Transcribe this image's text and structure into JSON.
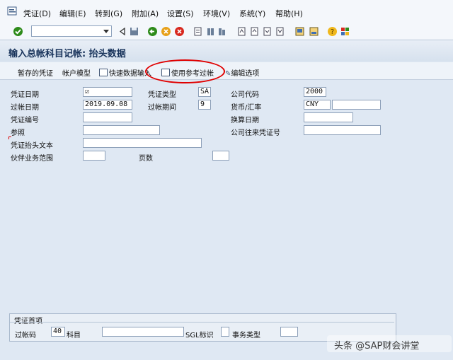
{
  "menu": [
    "凭证(D)",
    "编辑(E)",
    "转到(G)",
    "附加(A)",
    "设置(S)",
    "环境(V)",
    "系统(Y)",
    "帮助(H)"
  ],
  "toolbar": {
    "command_field": "",
    "icons": [
      "enter-icon",
      "back-icon",
      "save-icon",
      "back-green-icon",
      "exit-icon",
      "cancel-icon",
      "print-icon",
      "find-icon",
      "find-next-icon",
      "first-page-icon",
      "prev-page-icon",
      "next-page-icon",
      "last-page-icon",
      "new-session-icon",
      "shortcut-icon",
      "help-icon",
      "layout-icon"
    ],
    "colors": {
      "enter": "#2e8b1a",
      "back": "#2e8b1a",
      "exit": "#e7a01a",
      "cancel": "#d8281e"
    }
  },
  "title": "输入总帐科目记帐: 抬头数据",
  "app_toolbar": {
    "parked_doc": "暂存的凭证",
    "account_model": "帐户模型",
    "fast_entry": "快速数据输入",
    "reference_posting": "使用参考过帐",
    "editing_options": "编辑选项"
  },
  "form": {
    "doc_date_label": "凭证日期",
    "doc_date_value": "☑",
    "posting_date_label": "过帐日期",
    "posting_date_value": "2019.09.08",
    "doc_number_label": "凭证编号",
    "doc_number_value": "",
    "reference_label": "参照",
    "reference_value": "",
    "header_text_label": "凭证抬头文本",
    "header_text_value": "",
    "trading_partner_label": "伙伴业务范围",
    "trading_partner_value": "",
    "doc_type_label": "凭证类型",
    "doc_type_value": "SA",
    "period_label": "过帐期间",
    "period_value": "9",
    "page_label": "页数",
    "page_value": "",
    "company_code_label": "公司代码",
    "company_code_value": "2000",
    "currency_label": "货币/汇率",
    "currency_value": "CNY",
    "rate_value": "",
    "translation_date_label": "换算日期",
    "translation_date_value": "",
    "cross_cc_label": "公司往来凭证号",
    "cross_cc_value": ""
  },
  "first_item": {
    "group_title": "凭证首项",
    "posting_key_label": "过帐码",
    "posting_key_value": "40",
    "account_label": "科目",
    "account_value": "",
    "sgl_label": "SGL标识",
    "sgl_value": "",
    "transaction_type_label": "事务类型",
    "transaction_type_value": ""
  },
  "watermark": "头条 @SAP财会讲堂",
  "highlight_color": "#e00000"
}
